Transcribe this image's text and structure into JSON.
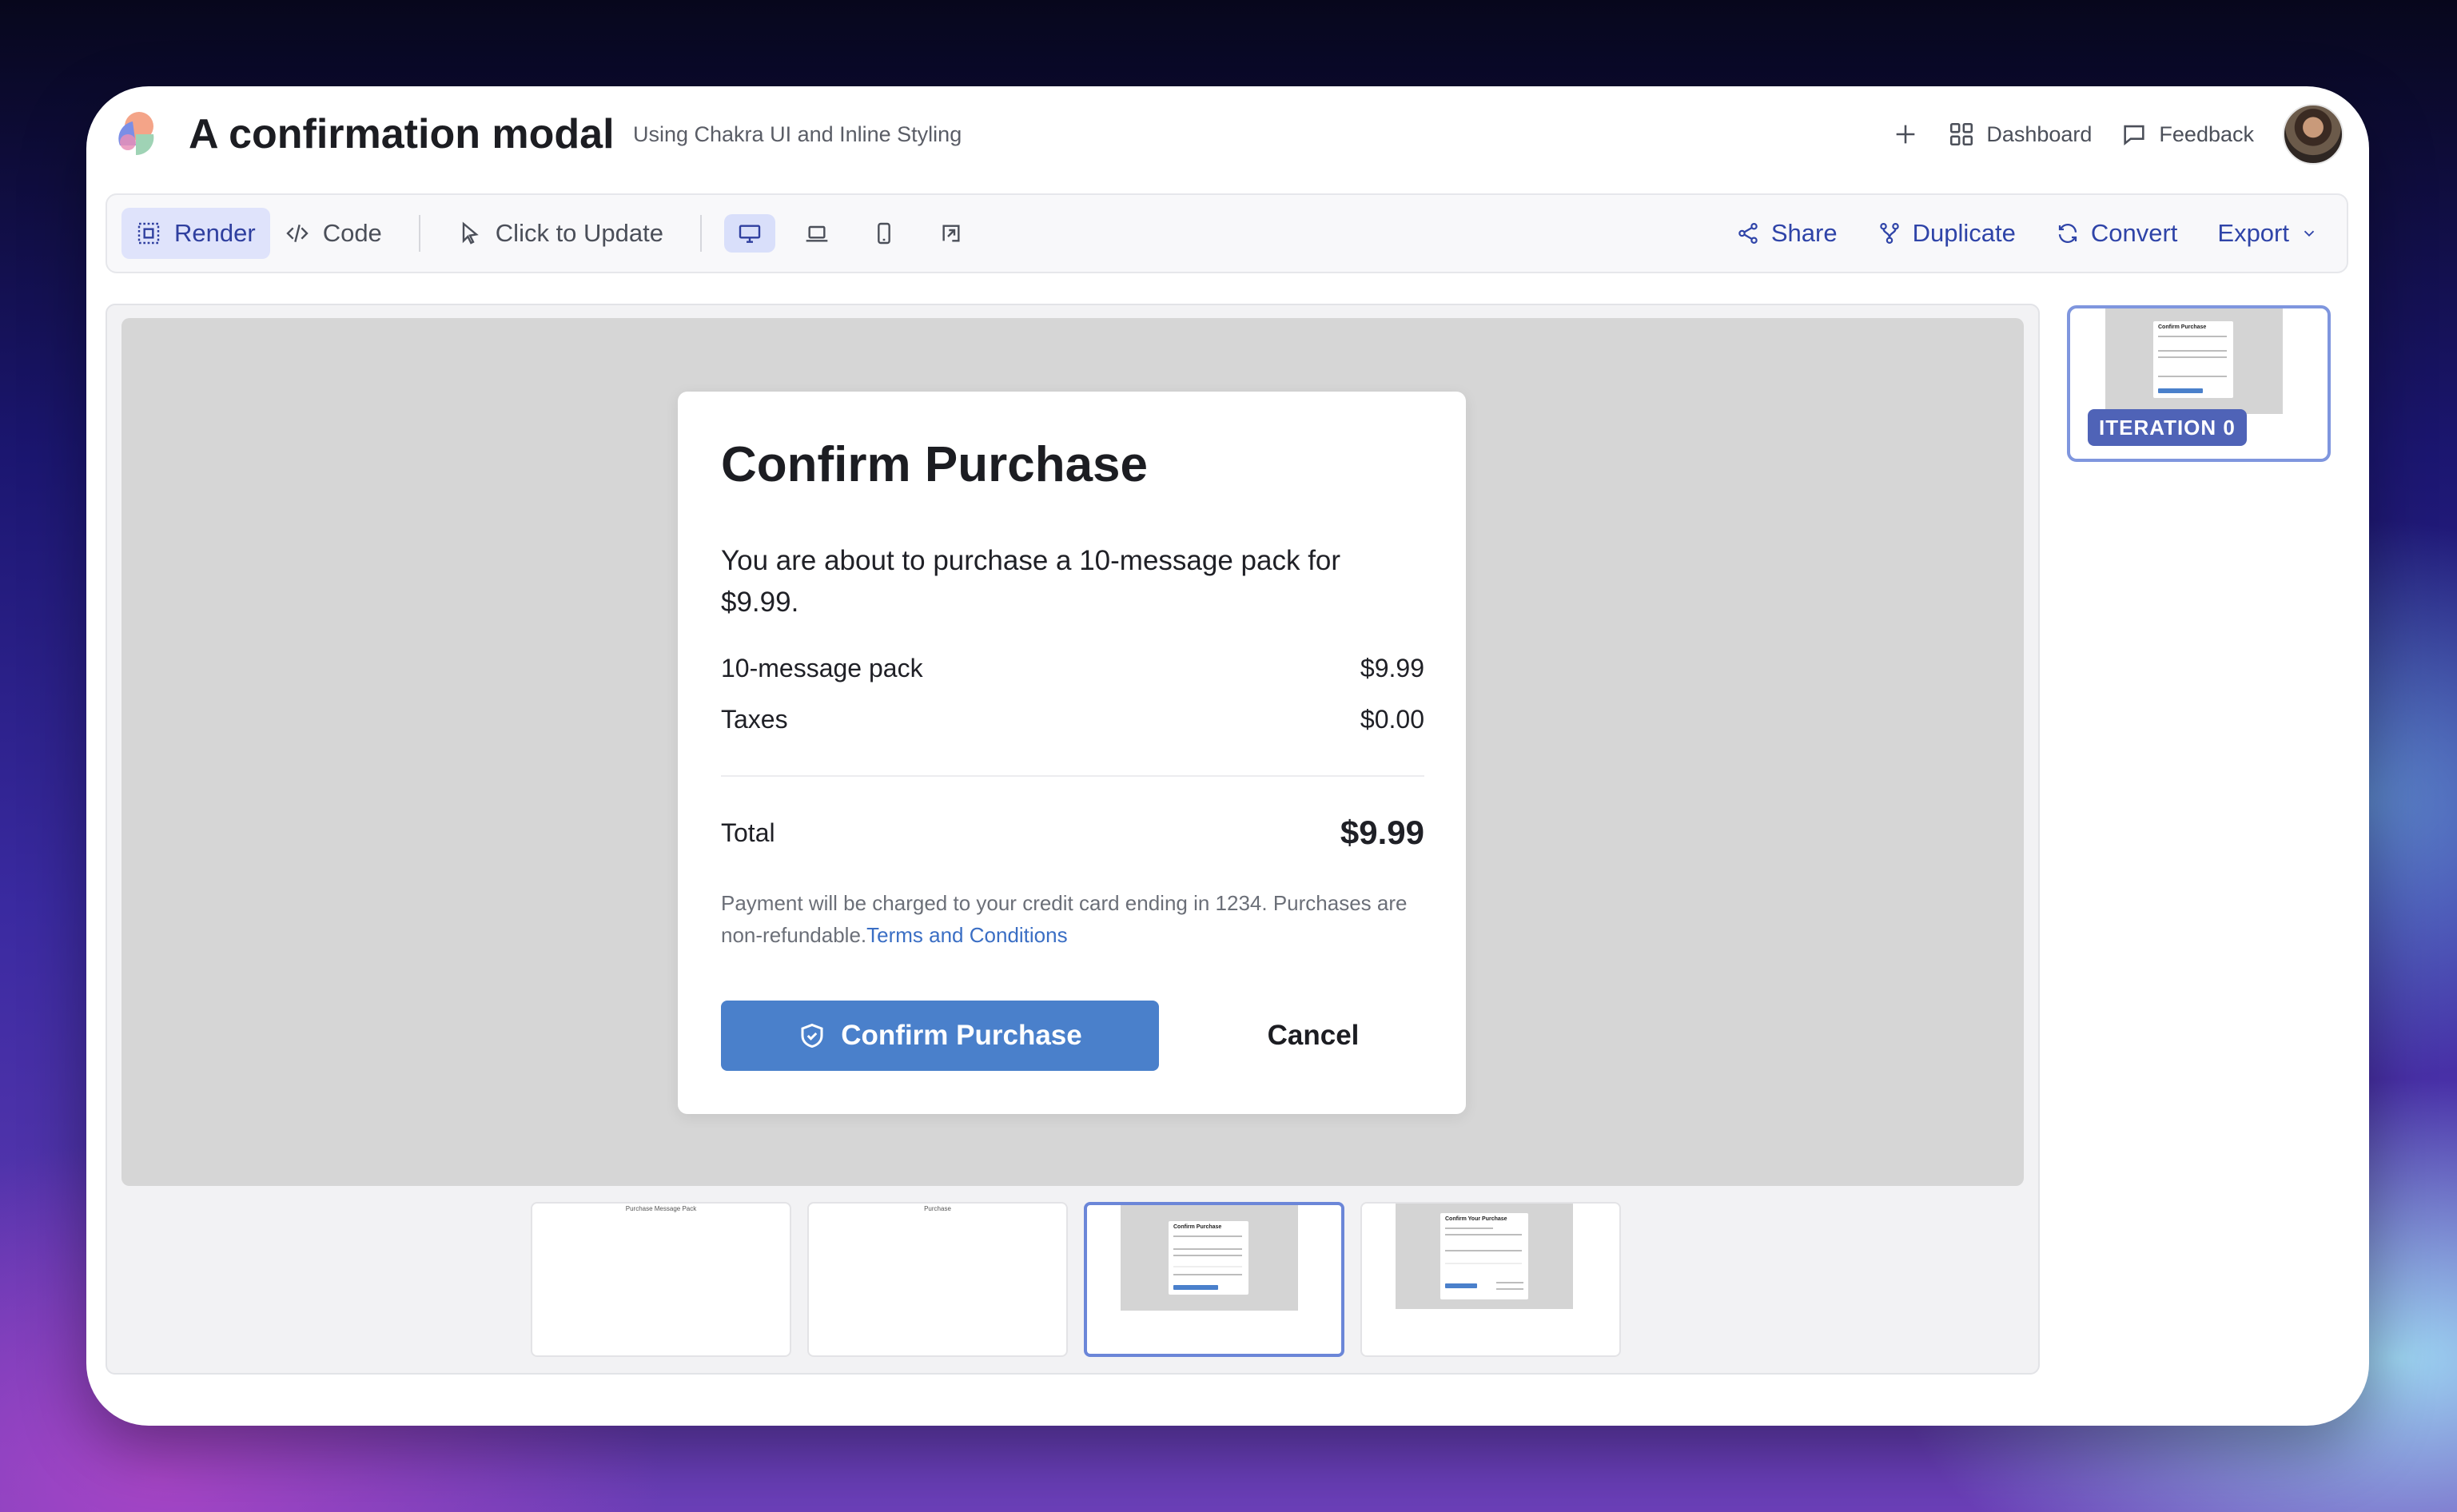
{
  "header": {
    "title": "A confirmation modal",
    "subtitle": "Using Chakra UI and Inline Styling",
    "dashboard_label": "Dashboard",
    "feedback_label": "Feedback"
  },
  "toolbar": {
    "render_label": "Render",
    "code_label": "Code",
    "click_to_update_label": "Click to Update",
    "share_label": "Share",
    "duplicate_label": "Duplicate",
    "convert_label": "Convert",
    "export_label": "Export",
    "active_view": "Render",
    "active_device": "desktop"
  },
  "modal": {
    "title": "Confirm Purchase",
    "description": "You are about to purchase a 10-message pack for $9.99.",
    "items": [
      {
        "label": "10-message pack",
        "value": "$9.99"
      },
      {
        "label": "Taxes",
        "value": "$0.00"
      }
    ],
    "total_label": "Total",
    "total_value": "$9.99",
    "note": "Payment will be charged to your credit card ending in 1234. Purchases are non-refundable.",
    "terms_link": "Terms and Conditions",
    "confirm_label": "Confirm Purchase",
    "cancel_label": "Cancel"
  },
  "thumbnails": {
    "t1_caption": "Purchase Message Pack",
    "t2_caption": "Purchase",
    "t3_title": "Confirm Purchase",
    "t4_title": "Confirm Your Purchase",
    "active_index": 2
  },
  "iteration": {
    "badge": "ITERATION 0",
    "preview_title": "Confirm Purchase"
  },
  "colors": {
    "accent": "#4a80cb",
    "toolbar_accent": "#2f44a8",
    "badge": "#4f63b7"
  }
}
